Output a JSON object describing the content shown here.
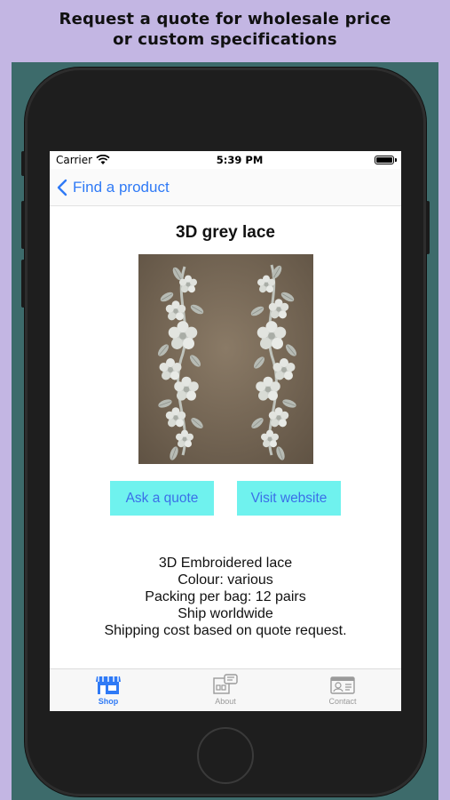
{
  "banner": {
    "line1": "Request a quote for wholesale price",
    "line2": "or custom specifications"
  },
  "statusbar": {
    "carrier": "Carrier",
    "time": "5:39 PM"
  },
  "nav": {
    "back_label": "Find a product"
  },
  "product": {
    "title": "3D grey lace",
    "image": "lace-appliques-photo",
    "description": [
      "3D Embroidered lace",
      "Colour: various",
      "Packing per bag: 12 pairs",
      "Ship worldwide",
      "Shipping cost based on quote request."
    ]
  },
  "actions": {
    "ask_quote": "Ask a quote",
    "visit_website": "Visit website"
  },
  "tabs": [
    {
      "label": "Shop",
      "icon": "shop-icon",
      "active": true
    },
    {
      "label": "About",
      "icon": "about-icon",
      "active": false
    },
    {
      "label": "Contact",
      "icon": "contact-icon",
      "active": false
    }
  ],
  "colors": {
    "background": "#c3b6e3",
    "accent": "#2f7af6",
    "button_bg": "#6ff2ee"
  }
}
